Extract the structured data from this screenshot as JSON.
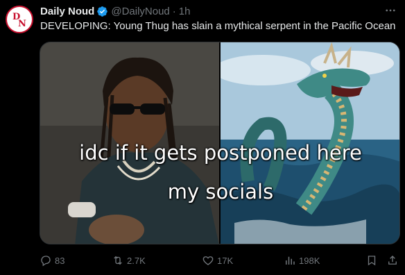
{
  "account": {
    "display_name": "Daily Noud",
    "handle": "@DailyNoud",
    "separator": "·",
    "timestamp": "1h",
    "verified": true,
    "avatar_text": "DN",
    "avatar_color": "#c8102e"
  },
  "tweet": {
    "text": "DEVELOPING: Young Thug has slain a mythical serpent in the Pacific Ocean"
  },
  "media": {
    "overlay_line1": "idc if it gets postponed here",
    "overlay_line2": "my socials"
  },
  "actions": {
    "replies": "83",
    "reposts": "2.7K",
    "likes": "17K",
    "views": "198K"
  },
  "icons": {
    "more": "more-horizontal-icon",
    "reply": "reply-icon",
    "repost": "repost-icon",
    "like": "heart-icon",
    "views": "views-chart-icon",
    "bookmark": "bookmark-icon",
    "share": "share-icon"
  },
  "colors": {
    "background": "#000000",
    "text": "#e7e9ea",
    "muted": "#71767b",
    "verified_blue": "#1d9bf0"
  }
}
